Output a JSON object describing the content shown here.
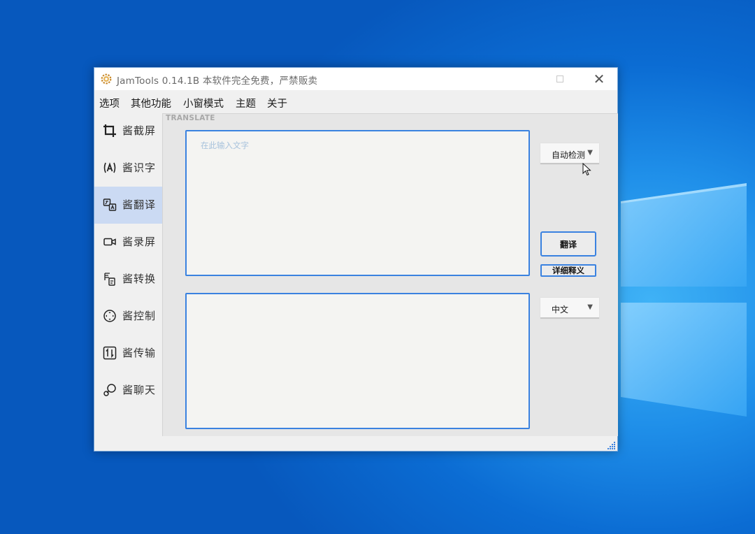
{
  "window": {
    "title": "JamTools 0.14.1B 本软件完全免费，严禁贩卖"
  },
  "menu": {
    "items": [
      {
        "label": "选项"
      },
      {
        "label": "其他功能"
      },
      {
        "label": "小窗模式"
      },
      {
        "label": "主题"
      },
      {
        "label": "关于"
      }
    ]
  },
  "sidebar": {
    "items": [
      {
        "label": "酱截屏",
        "icon": "crop-icon"
      },
      {
        "label": "酱识字",
        "icon": "ocr-icon"
      },
      {
        "label": "酱翻译",
        "icon": "translate-icon",
        "active": true
      },
      {
        "label": "酱录屏",
        "icon": "video-camera-icon"
      },
      {
        "label": "酱转换",
        "icon": "convert-file-icon"
      },
      {
        "label": "酱控制",
        "icon": "control-icon"
      },
      {
        "label": "酱传输",
        "icon": "transfer-icon"
      },
      {
        "label": "酱聊天",
        "icon": "chat-icon"
      }
    ]
  },
  "translate": {
    "panel_label": "TRANSLATE",
    "source_placeholder": "在此输入文字",
    "source_language": "自动检测",
    "target_language": "中文",
    "translate_label": "翻译",
    "detail_label": "详细释义"
  },
  "colors": {
    "accent": "#3a82e0",
    "active_nav": "#cbdaf3"
  }
}
